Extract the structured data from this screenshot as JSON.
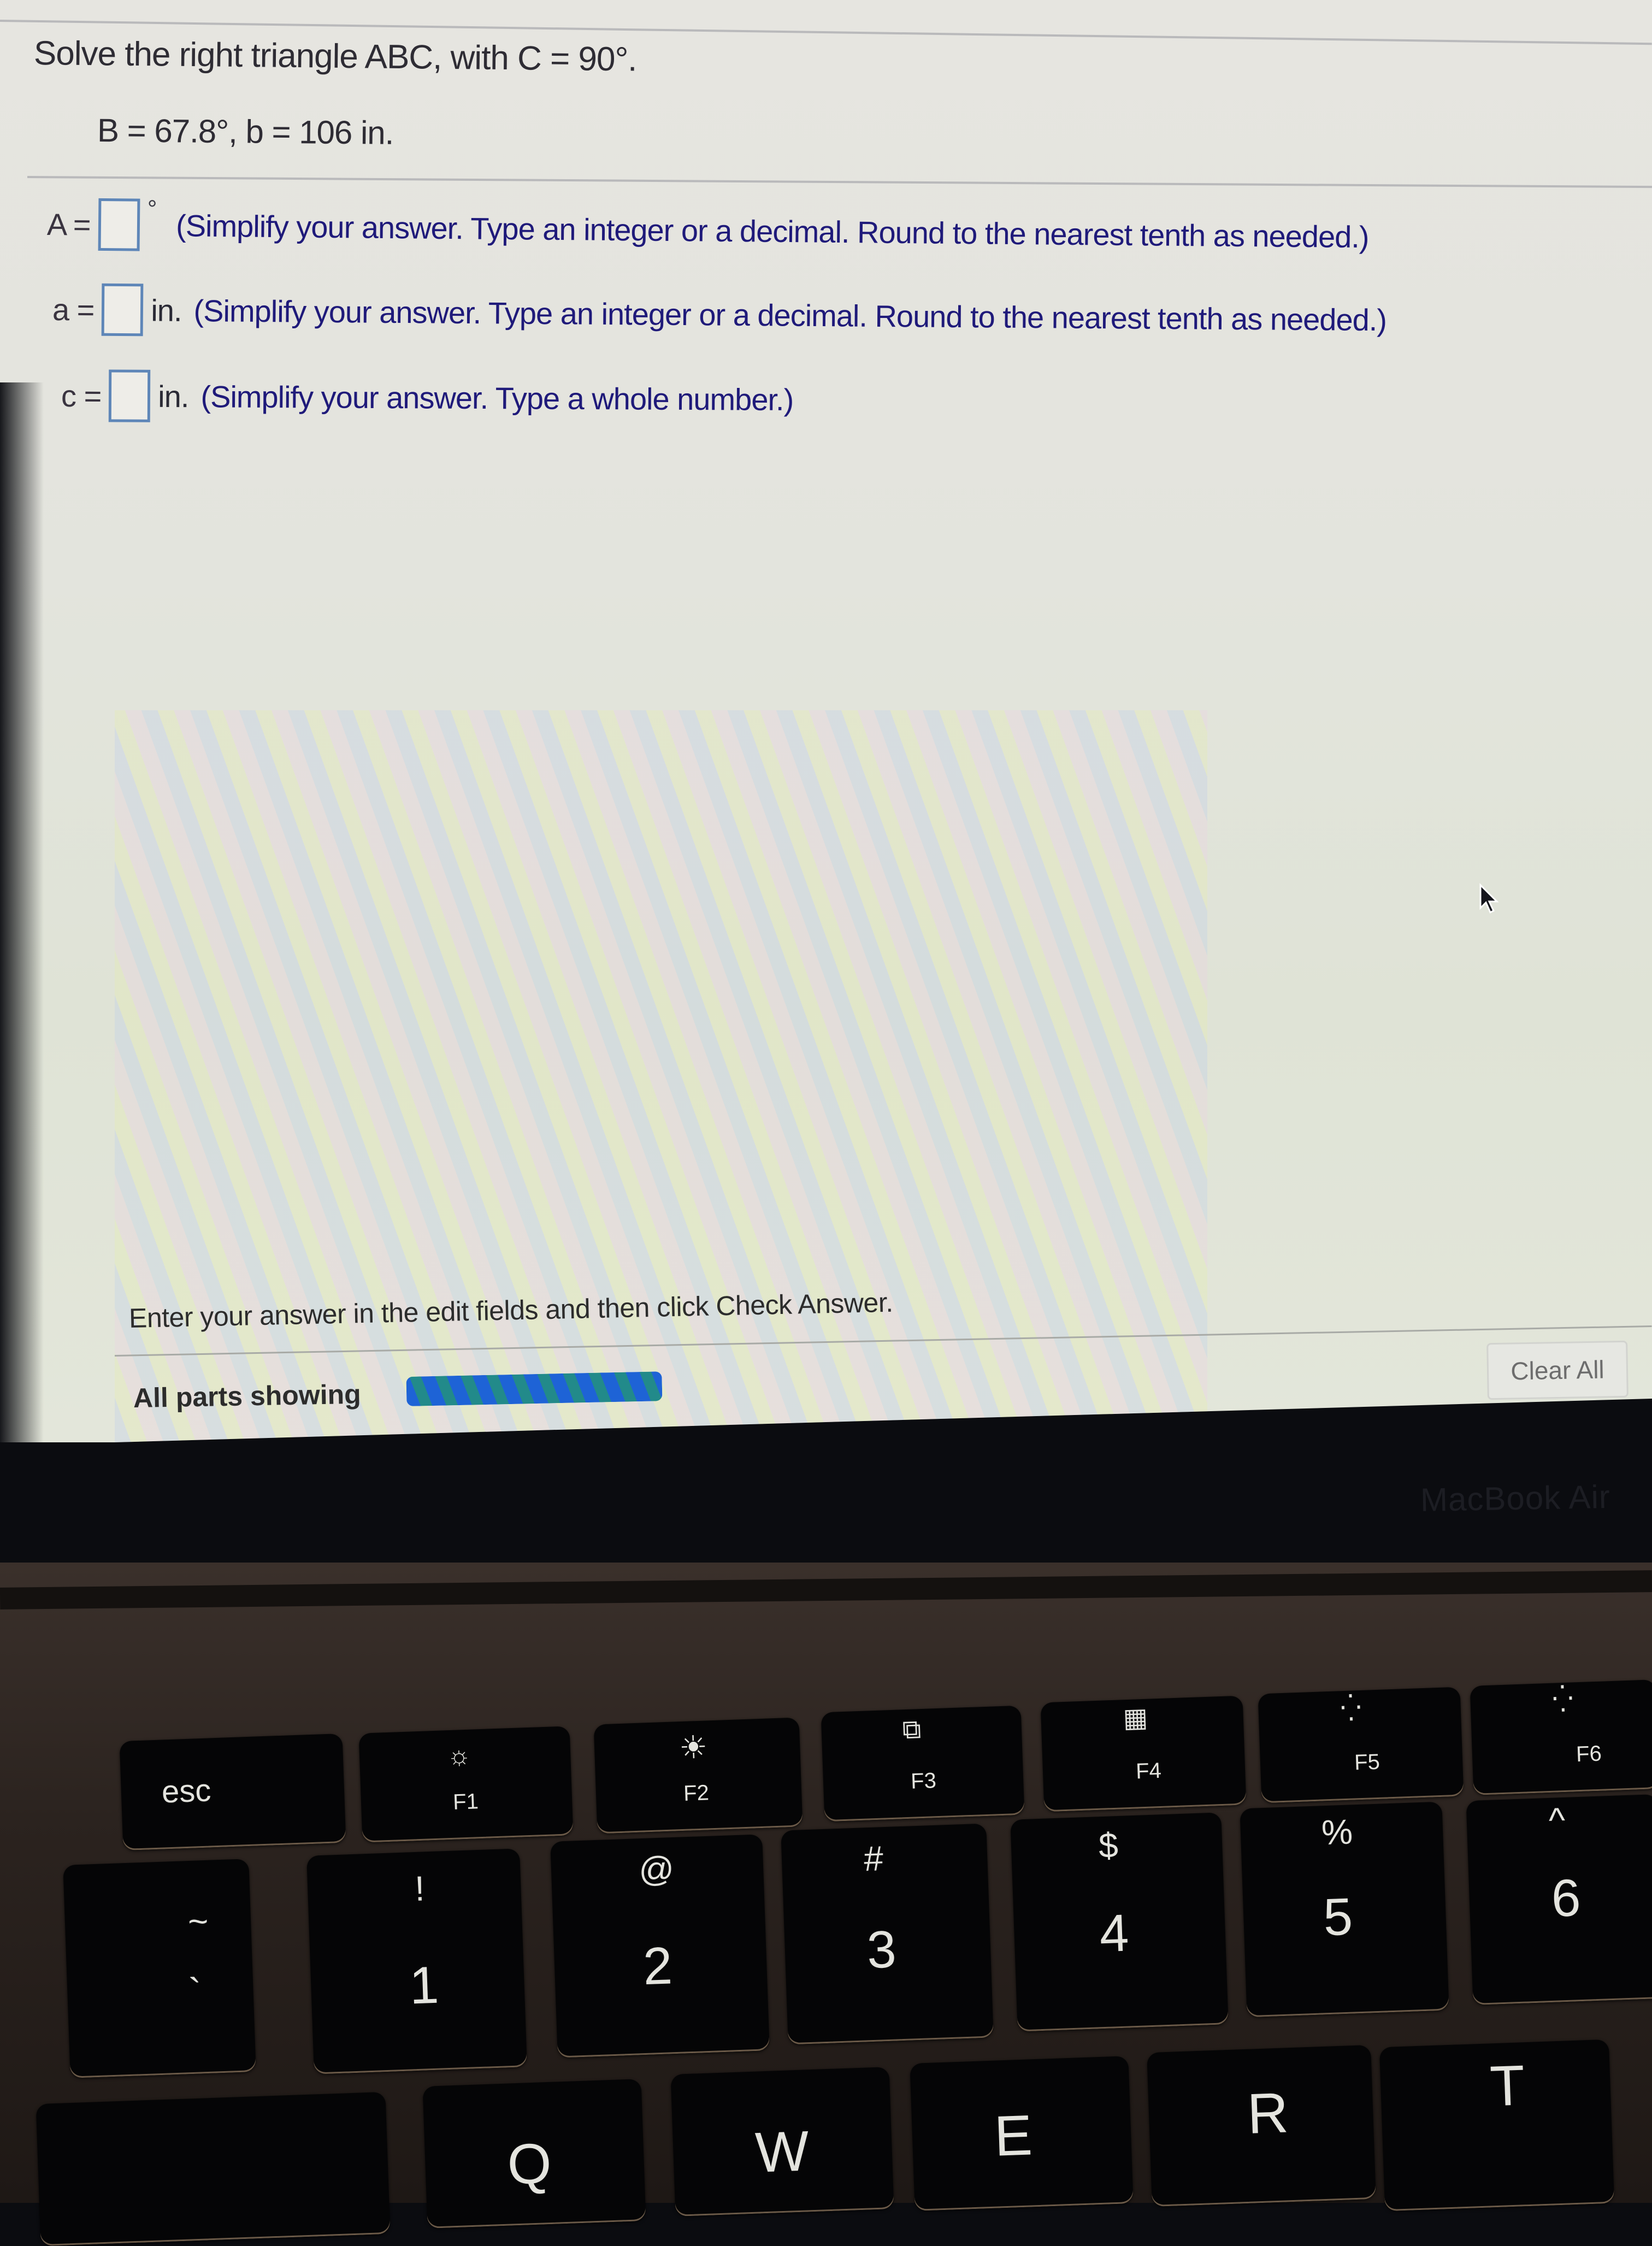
{
  "problem": {
    "question": "Solve the right triangle ABC, with C = 90°.",
    "given": "B = 67.8°, b = 106 in."
  },
  "answers": [
    {
      "variable": "A =",
      "value": "",
      "unit": "°",
      "hint": "(Simplify your answer. Type an integer or a decimal. Round to the nearest tenth as needed.)"
    },
    {
      "variable": "a =",
      "value": "",
      "unit": "in.",
      "hint": "(Simplify your answer. Type an integer or a decimal. Round to the nearest tenth as needed.)"
    },
    {
      "variable": "c =",
      "value": "",
      "unit": "in.",
      "hint": "(Simplify your answer. Type a whole number.)"
    }
  ],
  "footer": {
    "instructions": "Enter your answer in the edit fields and then click Check Answer.",
    "parts_label": "All parts showing",
    "progress_percent": 100,
    "clear_all_label": "Clear All"
  },
  "device": {
    "brand_label": "MacBook Air"
  },
  "keyboard": {
    "function_row": [
      {
        "label": "esc",
        "icon": ""
      },
      {
        "label": "F1",
        "icon": "brightness-down-icon"
      },
      {
        "label": "F2",
        "icon": "brightness-up-icon"
      },
      {
        "label": "F3",
        "icon": "mission-control-icon"
      },
      {
        "label": "F4",
        "icon": "launchpad-icon"
      },
      {
        "label": "F5",
        "icon": "keyboard-backlight-down-icon"
      },
      {
        "label": "F6",
        "icon": "keyboard-backlight-up-icon"
      }
    ],
    "number_row": [
      {
        "top": "~",
        "bottom": "`"
      },
      {
        "top": "!",
        "bottom": "1"
      },
      {
        "top": "@",
        "bottom": "2"
      },
      {
        "top": "#",
        "bottom": "3"
      },
      {
        "top": "$",
        "bottom": "4"
      },
      {
        "top": "%",
        "bottom": "5"
      },
      {
        "top": "^",
        "bottom": "6"
      }
    ],
    "letter_row": [
      "Q",
      "W",
      "E",
      "R",
      "T"
    ]
  },
  "colors": {
    "hint_text": "#1f1a7a",
    "input_border": "#5e86b8",
    "progress_fill": "#1e63d6"
  }
}
